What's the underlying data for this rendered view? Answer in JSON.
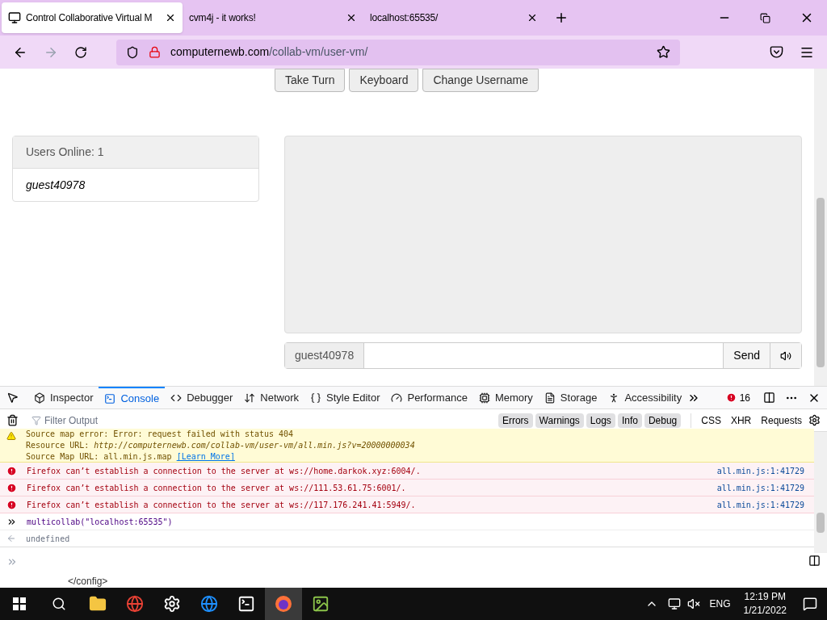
{
  "browser_tabs": [
    {
      "title": "Control Collaborative Virtual M",
      "selected": true
    },
    {
      "title": "cvm4j - it works!",
      "selected": false
    },
    {
      "title": "localhost:65535/",
      "selected": false
    }
  ],
  "address": {
    "domain": "computernewb.com",
    "path": "/collab-vm/user-vm/"
  },
  "vm_buttons": [
    "Take Turn",
    "Keyboard",
    "Change Username"
  ],
  "users_panel": {
    "heading": "Users Online: 1",
    "users": [
      "guest40978"
    ]
  },
  "chat": {
    "username": "guest40978",
    "send": "Send"
  },
  "devtools": {
    "tabs": [
      {
        "label": "Inspector",
        "selected": false
      },
      {
        "label": "Console",
        "selected": true
      },
      {
        "label": "Debugger",
        "selected": false
      },
      {
        "label": "Network",
        "selected": false
      },
      {
        "label": "Style Editor",
        "selected": false
      },
      {
        "label": "Performance",
        "selected": false
      },
      {
        "label": "Memory",
        "selected": false
      },
      {
        "label": "Storage",
        "selected": false
      },
      {
        "label": "Accessibility",
        "selected": false
      }
    ],
    "error_count": "16",
    "filter_placeholder": "Filter Output",
    "levels": [
      {
        "label": "Errors",
        "selected": true
      },
      {
        "label": "Warnings",
        "selected": true
      },
      {
        "label": "Logs",
        "selected": true
      },
      {
        "label": "Info",
        "selected": true
      },
      {
        "label": "Debug",
        "selected": true
      }
    ],
    "extra_filters": [
      "CSS",
      "XHR",
      "Requests"
    ],
    "messages": [
      {
        "kind": "warning",
        "lines": [
          "Source map error: Error: request failed with status 404",
          "Resource URL: *http://computernewb.com/collab-vm/user-vm/all.min.js?v=20000000034*",
          "Source Map URL: all.min.js.map"
        ],
        "link": "[Learn More]"
      },
      {
        "kind": "error",
        "text": "Firefox can’t establish a connection to the server at ws://home.darkok.xyz:6004/.",
        "source": "all.min.js:1:41729"
      },
      {
        "kind": "error",
        "text": "Firefox can’t establish a connection to the server at ws://111.53.61.75:6001/.",
        "source": "all.min.js:1:41729"
      },
      {
        "kind": "error",
        "text": "Firefox can’t establish a connection to the server at ws://117.176.241.41:5949/.",
        "source": "all.min.js:1:41729"
      },
      {
        "kind": "input",
        "text": "multicollab(\"localhost:65535\")"
      },
      {
        "kind": "result",
        "text": "undefined"
      }
    ]
  },
  "background_window_text": "</config>",
  "clock": {
    "time": "12:19 PM",
    "date": "1/21/2022"
  },
  "language": "ENG"
}
